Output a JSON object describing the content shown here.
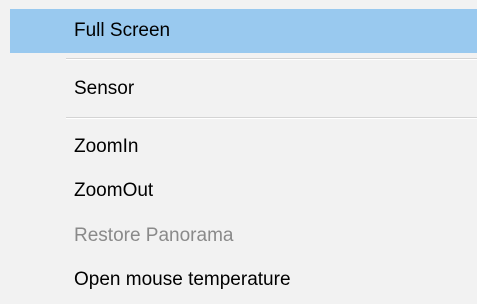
{
  "menu": {
    "highlight_color": "#99c9ef",
    "disabled_color": "#8a8a8a",
    "items": [
      {
        "label": "Full Screen",
        "state": "highlighted"
      },
      {
        "label": "Sensor",
        "state": "normal"
      },
      {
        "label": "ZoomIn",
        "state": "normal"
      },
      {
        "label": "ZoomOut",
        "state": "normal"
      },
      {
        "label": "Restore Panorama",
        "state": "disabled"
      },
      {
        "label": "Open mouse temperature",
        "state": "normal"
      }
    ]
  }
}
